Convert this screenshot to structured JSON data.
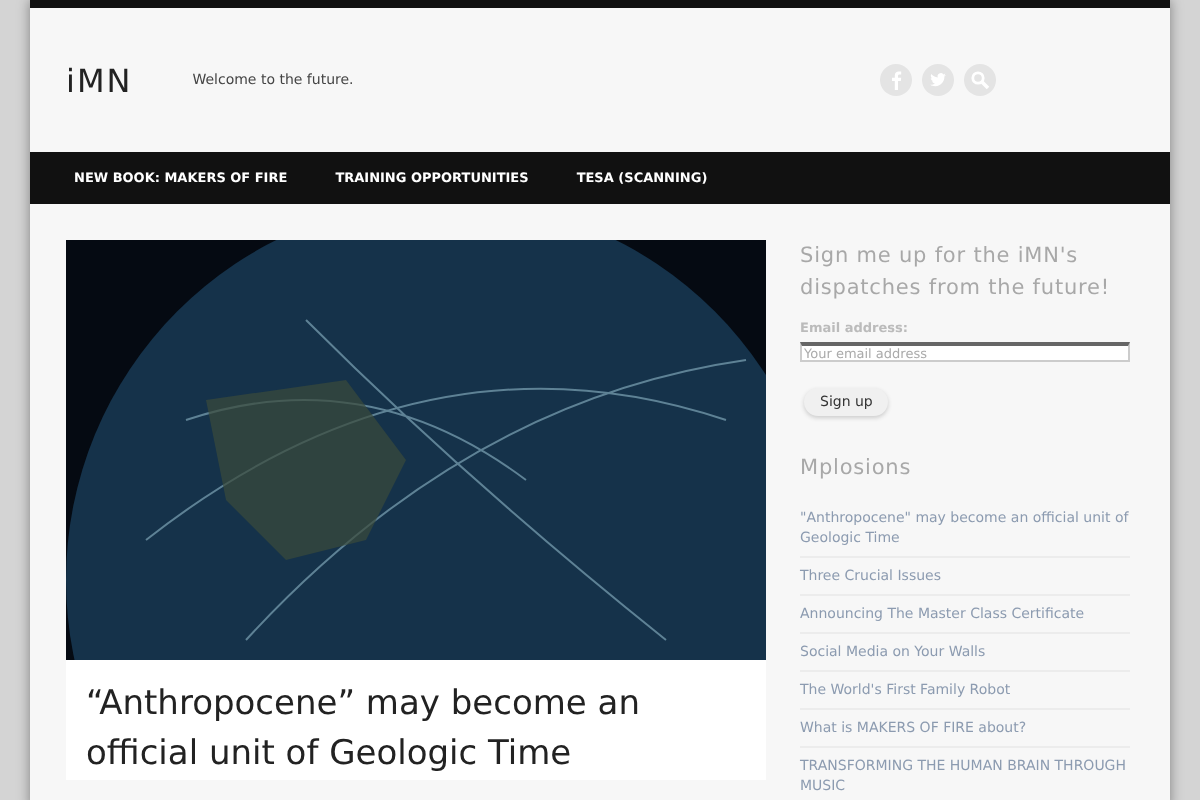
{
  "site": {
    "title": "iMN",
    "tagline": "Welcome to the future."
  },
  "nav": [
    "NEW BOOK: MAKERS OF FIRE",
    "TRAINING OPPORTUNITIES",
    "TESA (SCANNING)"
  ],
  "post": {
    "title": "“Anthropocene” may become an official unit of Geologic Time"
  },
  "signup": {
    "heading": "Sign me up for the iMN's dispatches from the future!",
    "email_label": "Email address:",
    "placeholder": "Your email address",
    "button": "Sign up"
  },
  "mplosions": {
    "heading": "Mplosions",
    "items": [
      "\"Anthropocene\" may become an official unit of Geologic Time",
      "Three Crucial Issues",
      "Announcing The Master Class Certificate",
      "Social Media on Your Walls",
      "The World's First Family Robot",
      "What is MAKERS OF FIRE about?",
      "TRANSFORMING THE HUMAN BRAIN THROUGH MUSIC"
    ]
  }
}
